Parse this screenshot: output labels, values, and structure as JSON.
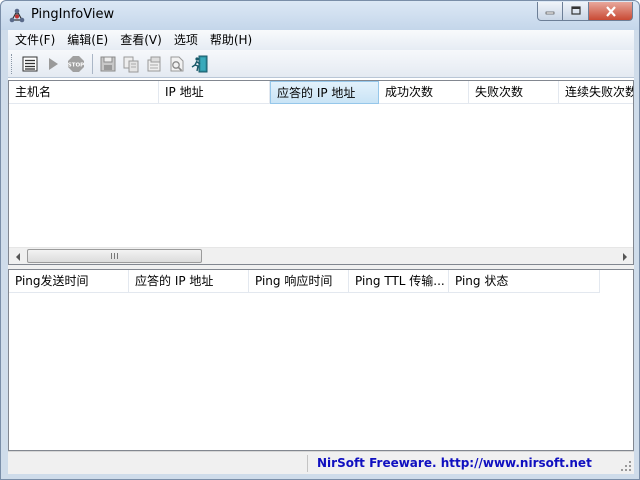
{
  "window": {
    "title": "PingInfoView",
    "icon": "network-nodes-icon"
  },
  "menu": {
    "items": [
      "文件(F)",
      "编辑(E)",
      "查看(V)",
      "选项",
      "帮助(H)"
    ]
  },
  "toolbar": {
    "buttons": [
      {
        "name": "options-icon"
      },
      {
        "name": "start-ping-icon"
      },
      {
        "name": "stop-ping-icon"
      },
      {
        "name": "save-icon"
      },
      {
        "name": "copy-icon"
      },
      {
        "name": "properties-icon"
      },
      {
        "name": "html-report-icon"
      },
      {
        "name": "exit-icon"
      }
    ]
  },
  "upper_list": {
    "columns": [
      "主机名",
      "IP 地址",
      "应答的 IP 地址",
      "成功次数",
      "失败次数",
      "连续失败次数"
    ],
    "active_column": "应答的 IP 地址",
    "rows": []
  },
  "lower_list": {
    "columns": [
      "Ping发送时间",
      "应答的 IP 地址",
      "Ping 响应时间",
      "Ping TTL 传输...",
      "Ping 状态"
    ],
    "rows": []
  },
  "statusbar": {
    "left": "",
    "right": "NirSoft Freeware.  http://www.nirsoft.net"
  },
  "colors": {
    "title_gradient_top": "#dce8f5",
    "status_link": "#1010c0",
    "active_header": "#c9e4f6"
  }
}
